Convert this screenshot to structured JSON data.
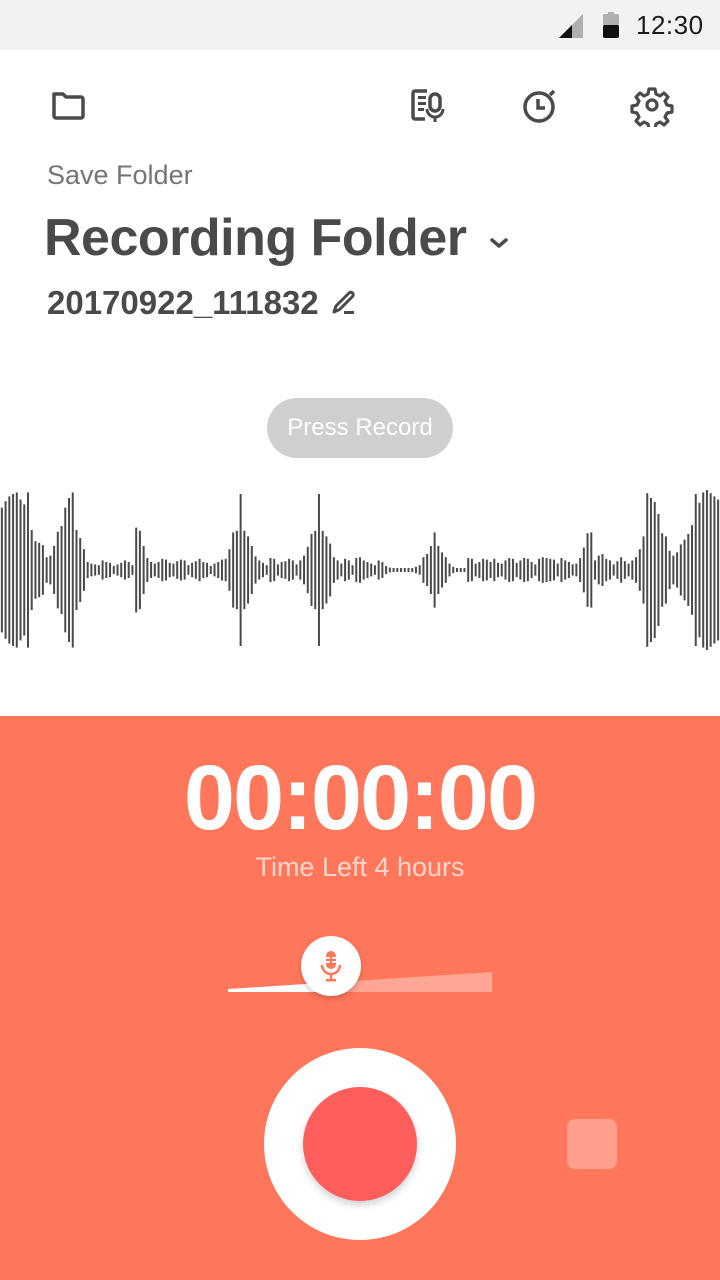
{
  "status_bar": {
    "time": "12:30",
    "signal_icon": "cell-signal-icon",
    "battery_icon": "battery-icon",
    "battery_level": 0.5
  },
  "toolbar": {
    "folder_icon": "folder-icon",
    "transcribe_icon": "voice-memo-list-icon",
    "timer_icon": "stopwatch-icon",
    "settings_icon": "gear-icon"
  },
  "header": {
    "save_folder_label": "Save Folder",
    "folder_name": "Recording Folder",
    "file_name": "20170922_111832"
  },
  "hint": {
    "press_record": "Press Record"
  },
  "waveform": {
    "color": "#4a4a4a",
    "amplitudes": [
      0.78,
      0.86,
      0.92,
      0.95,
      0.97,
      0.88,
      0.82,
      0.97,
      0.5,
      0.36,
      0.34,
      0.31,
      0.16,
      0.18,
      0.3,
      0.48,
      0.55,
      0.78,
      0.9,
      0.97,
      0.5,
      0.4,
      0.26,
      0.1,
      0.08,
      0.07,
      0.06,
      0.12,
      0.1,
      0.09,
      0.05,
      0.07,
      0.09,
      0.12,
      0.1,
      0.06,
      0.53,
      0.49,
      0.3,
      0.15,
      0.1,
      0.08,
      0.1,
      0.14,
      0.13,
      0.09,
      0.08,
      0.11,
      0.13,
      0.12,
      0.06,
      0.09,
      0.11,
      0.14,
      0.1,
      0.09,
      0.05,
      0.08,
      0.1,
      0.13,
      0.14,
      0.26,
      0.47,
      0.49,
      0.95,
      0.49,
      0.42,
      0.3,
      0.17,
      0.12,
      0.09,
      0.06,
      0.15,
      0.14,
      0.07,
      0.1,
      0.11,
      0.14,
      0.12,
      0.07,
      0.12,
      0.18,
      0.29,
      0.45,
      0.49,
      0.95,
      0.49,
      0.42,
      0.33,
      0.16,
      0.12,
      0.08,
      0.14,
      0.12,
      0.06,
      0.15,
      0.16,
      0.12,
      0.1,
      0.08,
      0.06,
      0.12,
      0.1,
      0.05,
      0.03,
      0.02,
      0.02,
      0.02,
      0.02,
      0.02,
      0.02,
      0.04,
      0.06,
      0.16,
      0.2,
      0.3,
      0.47,
      0.3,
      0.22,
      0.16,
      0.08,
      0.04,
      0.02,
      0.02,
      0.02,
      0.15,
      0.14,
      0.08,
      0.1,
      0.14,
      0.13,
      0.1,
      0.14,
      0.09,
      0.08,
      0.12,
      0.15,
      0.14,
      0.09,
      0.12,
      0.15,
      0.14,
      0.1,
      0.07,
      0.14,
      0.16,
      0.15,
      0.14,
      0.13,
      0.08,
      0.15,
      0.12,
      0.1,
      0.07,
      0.08,
      0.15,
      0.28,
      0.46,
      0.47,
      0.12,
      0.18,
      0.2,
      0.14,
      0.12,
      0.07,
      0.11,
      0.16,
      0.11,
      0.08,
      0.12,
      0.16,
      0.26,
      0.42,
      0.96,
      0.9,
      0.85,
      0.7,
      0.46,
      0.42,
      0.24,
      0.18,
      0.22,
      0.32,
      0.38,
      0.45,
      0.56,
      0.95,
      0.84,
      0.97,
      1.0,
      0.96,
      0.92,
      0.88
    ],
    "bar_spacing_note": "uniform"
  },
  "recorder": {
    "elapsed": "00:00:00",
    "time_left": "Time Left 4 hours",
    "input_gain": 0.39,
    "mic_icon": "microphone-icon",
    "record_button": "record-button",
    "stop_button": "stop-button"
  },
  "colors": {
    "panel": "#ff775b",
    "record_inner": "#ff5f5c",
    "stop": "#ffa08c",
    "text_dark": "#4a4a4a",
    "text_muted": "#757575",
    "pill": "#cfcfcf"
  }
}
